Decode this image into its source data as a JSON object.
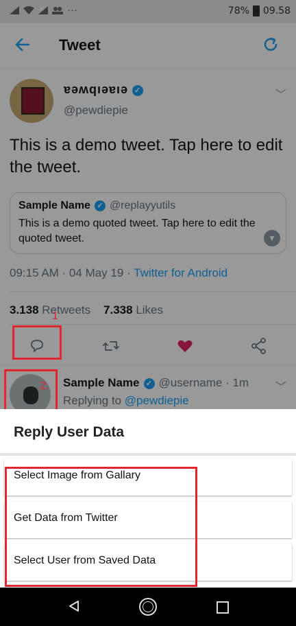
{
  "status_bar": {
    "battery": "78%",
    "time": "09.58",
    "more": "···"
  },
  "app_bar": {
    "title": "Tweet"
  },
  "tweet": {
    "display_name": "ɐǝʍqıǝɐıǝ",
    "handle": "@pewdiepie",
    "text": "This is a demo tweet. Tap here to edit the tweet.",
    "quote": {
      "name": "Sample Name",
      "handle": "@replayyutils",
      "text": "This is a demo quoted tweet. Tap here to edit the quoted tweet."
    },
    "time": "09:15 AM · 04 May 19 · ",
    "client": "Twitter for Android",
    "retweets_count": "3.138",
    "retweets_label": " Retweets",
    "likes_count": "7.338",
    "likes_label": " Likes"
  },
  "annotations": {
    "marker1": "1",
    "marker2": "2."
  },
  "reply": {
    "name": "Sample Name",
    "handle_time": "@username · 1m",
    "replying_to_prefix": "Replying to ",
    "replying_to": "@pewdiepie"
  },
  "sheet": {
    "title": "Reply User Data",
    "options": [
      {
        "label": "Select Image from Gallary"
      },
      {
        "label": "Get Data from Twitter"
      },
      {
        "label": "Select User from Saved Data"
      }
    ]
  },
  "colors": {
    "accent": "#1da1f2",
    "like": "#e0245e",
    "highlight": "#e0262f"
  }
}
